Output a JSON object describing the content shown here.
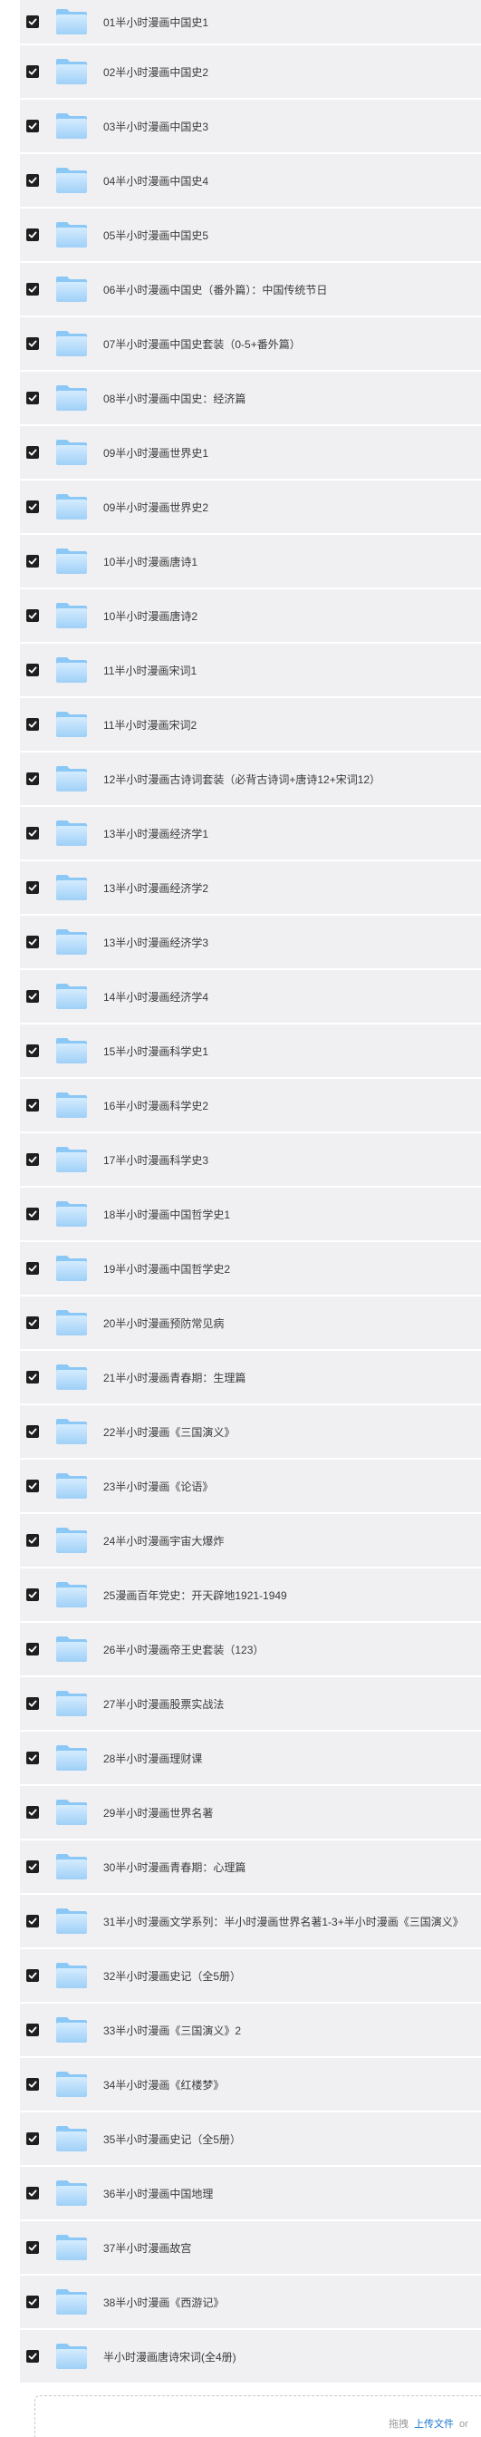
{
  "files": [
    {
      "name": "01半小时漫画中国史1"
    },
    {
      "name": "02半小时漫画中国史2"
    },
    {
      "name": "03半小时漫画中国史3"
    },
    {
      "name": "04半小时漫画中国史4"
    },
    {
      "name": "05半小时漫画中国史5"
    },
    {
      "name": "06半小时漫画中国史（番外篇）：中国传统节日"
    },
    {
      "name": "07半小时漫画中国史套装（0-5+番外篇）"
    },
    {
      "name": "08半小时漫画中国史：经济篇"
    },
    {
      "name": "09半小时漫画世界史1"
    },
    {
      "name": "09半小时漫画世界史2"
    },
    {
      "name": "10半小时漫画唐诗1"
    },
    {
      "name": "10半小时漫画唐诗2"
    },
    {
      "name": "11半小时漫画宋词1"
    },
    {
      "name": "11半小时漫画宋词2"
    },
    {
      "name": "12半小时漫画古诗词套装（必背古诗词+唐诗12+宋词12）"
    },
    {
      "name": "13半小时漫画经济学1"
    },
    {
      "name": "13半小时漫画经济学2"
    },
    {
      "name": "13半小时漫画经济学3"
    },
    {
      "name": "14半小时漫画经济学4"
    },
    {
      "name": "15半小时漫画科学史1"
    },
    {
      "name": "16半小时漫画科学史2"
    },
    {
      "name": "17半小时漫画科学史3"
    },
    {
      "name": "18半小时漫画中国哲学史1"
    },
    {
      "name": "19半小时漫画中国哲学史2"
    },
    {
      "name": "20半小时漫画预防常见病"
    },
    {
      "name": "21半小时漫画青春期：生理篇"
    },
    {
      "name": "22半小时漫画《三国演义》"
    },
    {
      "name": "23半小时漫画《论语》"
    },
    {
      "name": "24半小时漫画宇宙大爆炸"
    },
    {
      "name": "25漫画百年党史：开天辟地1921-1949"
    },
    {
      "name": "26半小时漫画帝王史套装（123）"
    },
    {
      "name": "27半小时漫画股票实战法"
    },
    {
      "name": "28半小时漫画理财课"
    },
    {
      "name": "29半小时漫画世界名著"
    },
    {
      "name": "30半小时漫画青春期：心理篇"
    },
    {
      "name": "31半小时漫画文学系列：半小时漫画世界名著1-3+半小时漫画《三国演义》"
    },
    {
      "name": "32半小时漫画史记（全5册）"
    },
    {
      "name": "33半小时漫画《三国演义》2"
    },
    {
      "name": "34半小时漫画《红楼梦》"
    },
    {
      "name": "35半小时漫画史记（全5册）"
    },
    {
      "name": "36半小时漫画中国地理"
    },
    {
      "name": "37半小时漫画故宫"
    },
    {
      "name": "38半小时漫画《西游记》"
    },
    {
      "name": "半小时漫画唐诗宋词(全4册)"
    }
  ],
  "upload": {
    "prefix": "拖拽",
    "link_label": "上传文件",
    "suffix": "or"
  },
  "colors": {
    "row_bg": "#f0f0f3",
    "checkbox": "#1f1f1f",
    "folder_light": "#bfe3ff",
    "folder_dark": "#8cc8f5",
    "link": "#1976d2"
  }
}
